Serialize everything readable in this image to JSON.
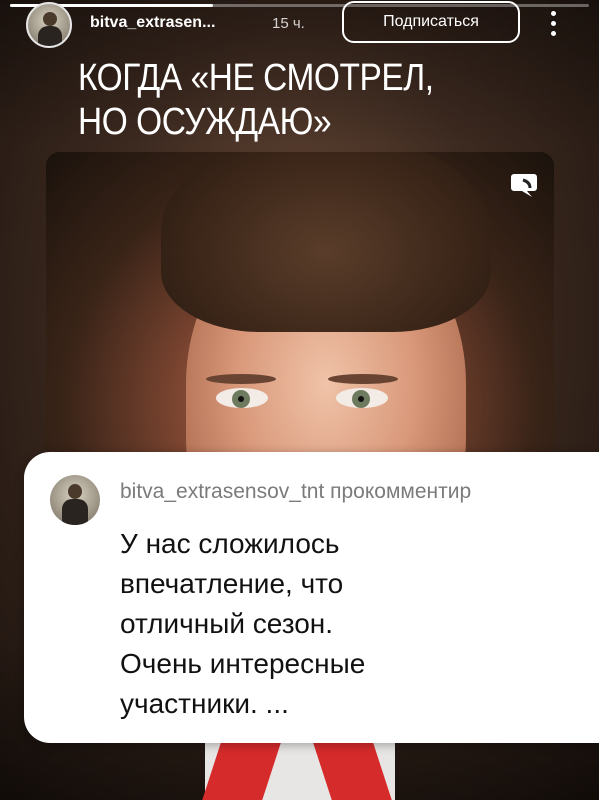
{
  "story": {
    "progress": 0.35,
    "title_lines": [
      "КОГДА «НЕ СМОТРЕЛ,",
      "НО ОСУЖДАЮ»"
    ]
  },
  "header": {
    "username": "bitva_extrasen...",
    "time": "15 ч.",
    "subscribe_label": "Подписаться",
    "more_icon": "more-vertical-icon"
  },
  "media": {
    "mute_icon": "speech-bubble-icon"
  },
  "comment": {
    "header": "bitva_extrasensov_tnt прокомментир",
    "text_lines": [
      "У нас сложилось",
      "впечатление, что",
      "отличный сезон.",
      "Очень интересные",
      "участники. ..."
    ]
  },
  "colors": {
    "background": "#3d2a20",
    "card": "#ffffff",
    "accent_red": "#d62b2b"
  }
}
